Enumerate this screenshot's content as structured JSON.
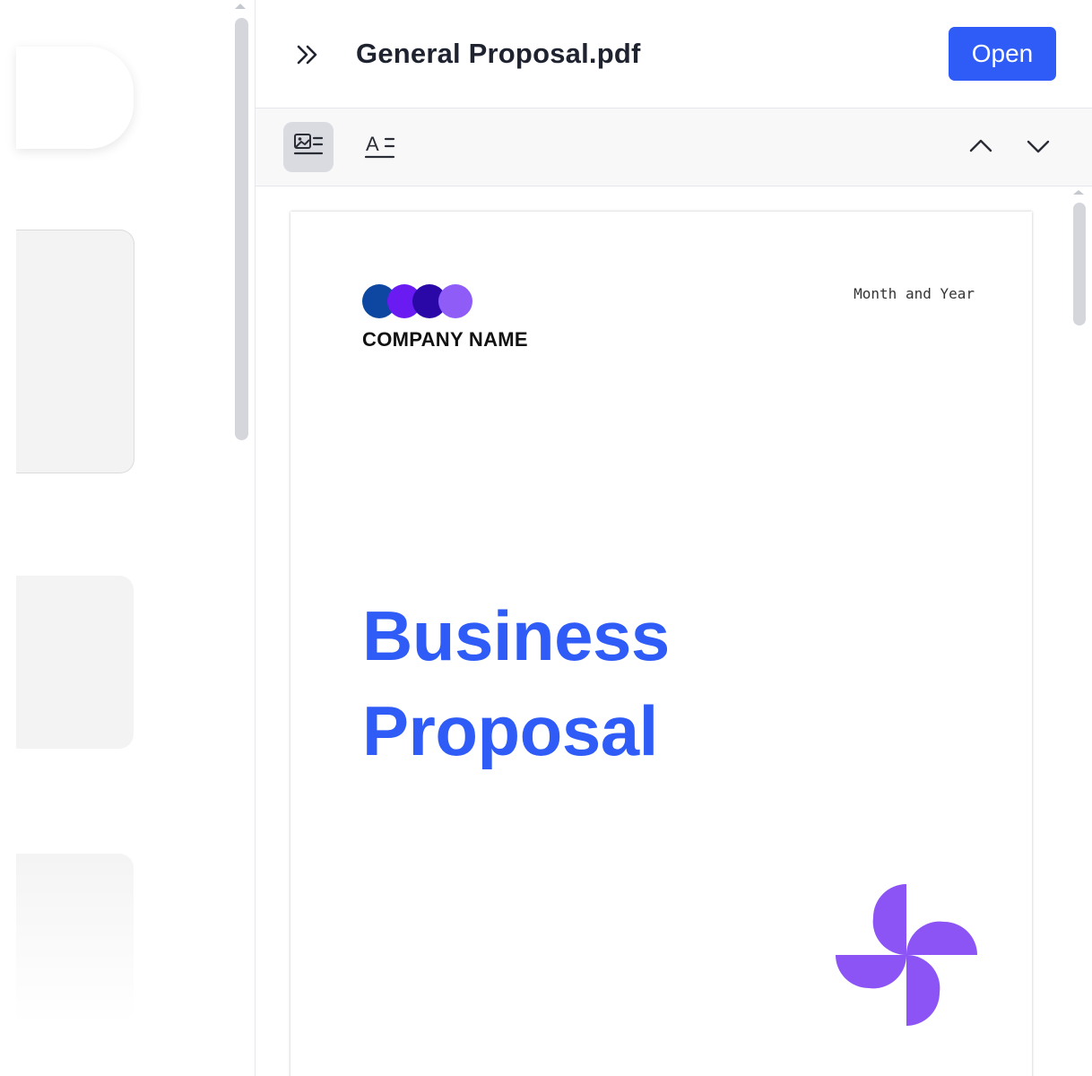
{
  "header": {
    "title": "General Proposal.pdf",
    "open_label": "Open"
  },
  "toolbar": {
    "thumbnail_view_icon": "image-list-icon",
    "text_view_icon": "text-list-icon",
    "text_view_glyph": "A",
    "prev_icon": "chevron-up-icon",
    "next_icon": "chevron-down-icon"
  },
  "document": {
    "company_name": "COMPANY NAME",
    "date_placeholder": "Month and Year",
    "title_line_1": "Business",
    "title_line_2": "Proposal",
    "logo_colors": [
      "#0d47a1",
      "#6a1bf2",
      "#2a08a8",
      "#8f5cf8"
    ],
    "pinwheel_color": "#8c53f5",
    "accent_color": "#2f5cf6"
  }
}
